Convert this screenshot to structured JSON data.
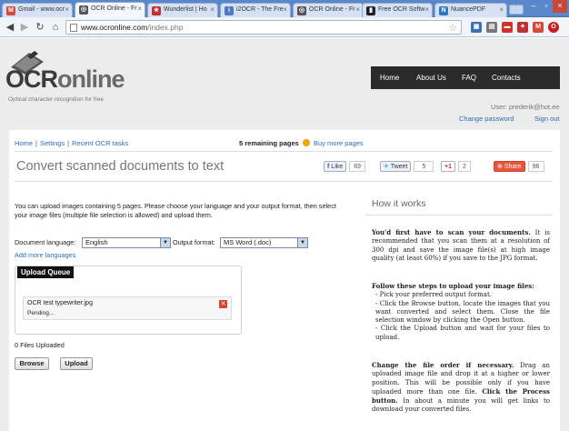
{
  "browser": {
    "tabs": [
      {
        "label": "Gmail - www.ocr",
        "icon": "gmail-icon",
        "color": "#d44a3a"
      },
      {
        "label": "OCR Online - Fr",
        "icon": "ocr-icon",
        "color": "#444444"
      },
      {
        "label": "Wunderlist | Ho",
        "icon": "wunderlist-icon",
        "color": "#c52e2e"
      },
      {
        "label": "i2OCR - The Fre",
        "icon": "i2ocr-icon",
        "color": "#4b7ac0"
      },
      {
        "label": "OCR Online - Fr",
        "icon": "ocr-icon",
        "color": "#444444"
      },
      {
        "label": "Free OCR Softw",
        "icon": "freeocr-icon",
        "color": "#222222"
      },
      {
        "label": "NuancePDF",
        "icon": "nuance-icon",
        "color": "#2b78c5"
      }
    ],
    "url_host": "www.ocronline.com",
    "url_path": "/index.php"
  },
  "site": {
    "logo_main": "OCR",
    "logo_sub": "online",
    "tagline": "Optical character recognition for free",
    "nav": [
      "Home",
      "About Us",
      "FAQ",
      "Contacts"
    ],
    "user": "User: prederik@hot.ee",
    "change_password": "Change password",
    "sign_out": "Sign out"
  },
  "breadcrumb": [
    "Home",
    "Settings",
    "Recent OCR tasks"
  ],
  "remaining": {
    "count": "5 remaining pages",
    "buy": "Buy more pages"
  },
  "page_title": "Convert scanned documents to text",
  "share": {
    "like": "Like",
    "like_count": "69",
    "tweet": "Tweet",
    "tweet_count": "5",
    "plus": "+1",
    "plus_count": "2",
    "share": "Share",
    "share_count": "96"
  },
  "upload": {
    "intro": "You can upload images containing 5 pages. Please choose your language and your output format, then select your image files (multiple file selection is allowed) and upload them.",
    "language_label": "Document language:",
    "language_value": "English",
    "format_label": "Output format:",
    "format_value": "MS Word (.doc)",
    "add_languages": "Add more languages",
    "queue_title": "Upload Queue",
    "file_name": "OCR test typewriter.jpg",
    "file_status": "Pending...",
    "files_uploaded": "0 Files Uploaded",
    "browse": "Browse",
    "upload": "Upload"
  },
  "how": {
    "title": "How it works",
    "p1_bold": "You'd first have to scan your documents.",
    "p1_rest": " It is recommended that you scan them at a resolution of 300 dpi and save the image file(s) at high image quality (at least 60%) if you save to the JPG format.",
    "p2_bold": "Follow these steps to upload your image files:",
    "p2_s1": "- Pick your preferred output format.",
    "p2_s2": "- Click the Browse button, locate the images that you want converted and select them. Close the file selection window by clicking the Open button.",
    "p2_s3": "- Click the Upload button and wait for your files to upload.",
    "p3_bold": "Change the file order if necessary.",
    "p3_rest": " Drag an uploaded image file and drop it at a higher or lower position. This will be possible only if you have uploaded more than one file. ",
    "p3_bold2": "Click the Process button.",
    "p3_rest2": " In about a minute you will get links to download your converted files."
  }
}
